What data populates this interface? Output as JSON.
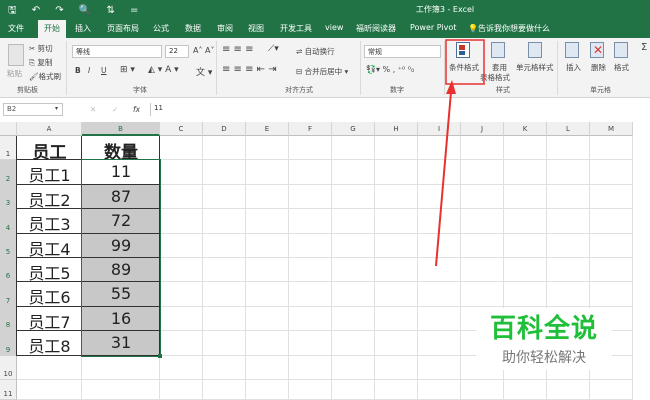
{
  "window": {
    "title": "工作簿3 - Excel",
    "quick_access": "🖫 ↶ ↷ 🔍 ⇅ ="
  },
  "tabs": [
    "文件",
    "开始",
    "插入",
    "页面布局",
    "公式",
    "数据",
    "审阅",
    "视图",
    "开发工具",
    "view",
    "福昕阅读器",
    "Power Pivot",
    "告诉我你想要做什么"
  ],
  "ribbon": {
    "clipboard": {
      "paste": "粘贴",
      "cut": "剪切",
      "copy": "复制",
      "format_painter": "格式刷",
      "label": "剪贴板"
    },
    "font": {
      "name": "等线",
      "size": "22",
      "bold": "B",
      "italic": "I",
      "underline": "U",
      "label": "字体"
    },
    "alignment": {
      "wrap": "自动换行",
      "merge": "合并后居中",
      "label": "对齐方式"
    },
    "number": {
      "format": "常规",
      "percent": "%",
      "comma": ",",
      "label": "数字"
    },
    "styles": {
      "conditional": "条件格式",
      "table_line1": "套用",
      "table_line2": "表格格式",
      "cell_styles": "单元格样式",
      "label": "样式"
    },
    "cells": {
      "insert": "插入",
      "delete": "删除",
      "format": "格式",
      "label": "单元格"
    }
  },
  "formula_bar": {
    "name_box": "B2",
    "value": "11",
    "cancel": "✕",
    "enter": "✓",
    "fx": "fx"
  },
  "columns": [
    "A",
    "B",
    "C",
    "D",
    "E",
    "F",
    "G",
    "H",
    "I",
    "J",
    "K",
    "L",
    "M"
  ],
  "rows": [
    "1",
    "2",
    "3",
    "4",
    "5",
    "6",
    "7",
    "8",
    "9",
    "10",
    "11"
  ],
  "table": {
    "headers": [
      "员工",
      "数量"
    ],
    "rows": [
      [
        "员工1",
        "11"
      ],
      [
        "员工2",
        "87"
      ],
      [
        "员工3",
        "72"
      ],
      [
        "员工4",
        "99"
      ],
      [
        "员工5",
        "89"
      ],
      [
        "员工6",
        "55"
      ],
      [
        "员工7",
        "16"
      ],
      [
        "员工8",
        "31"
      ]
    ]
  },
  "colors": {
    "excel_green": "#217346",
    "highlight_fill": "#c8c8c8",
    "annotation_red": "#e8312f",
    "watermark_green": "#1fbf3a"
  },
  "watermark": {
    "line1": "百科全说",
    "line2": "助你轻松解决"
  }
}
